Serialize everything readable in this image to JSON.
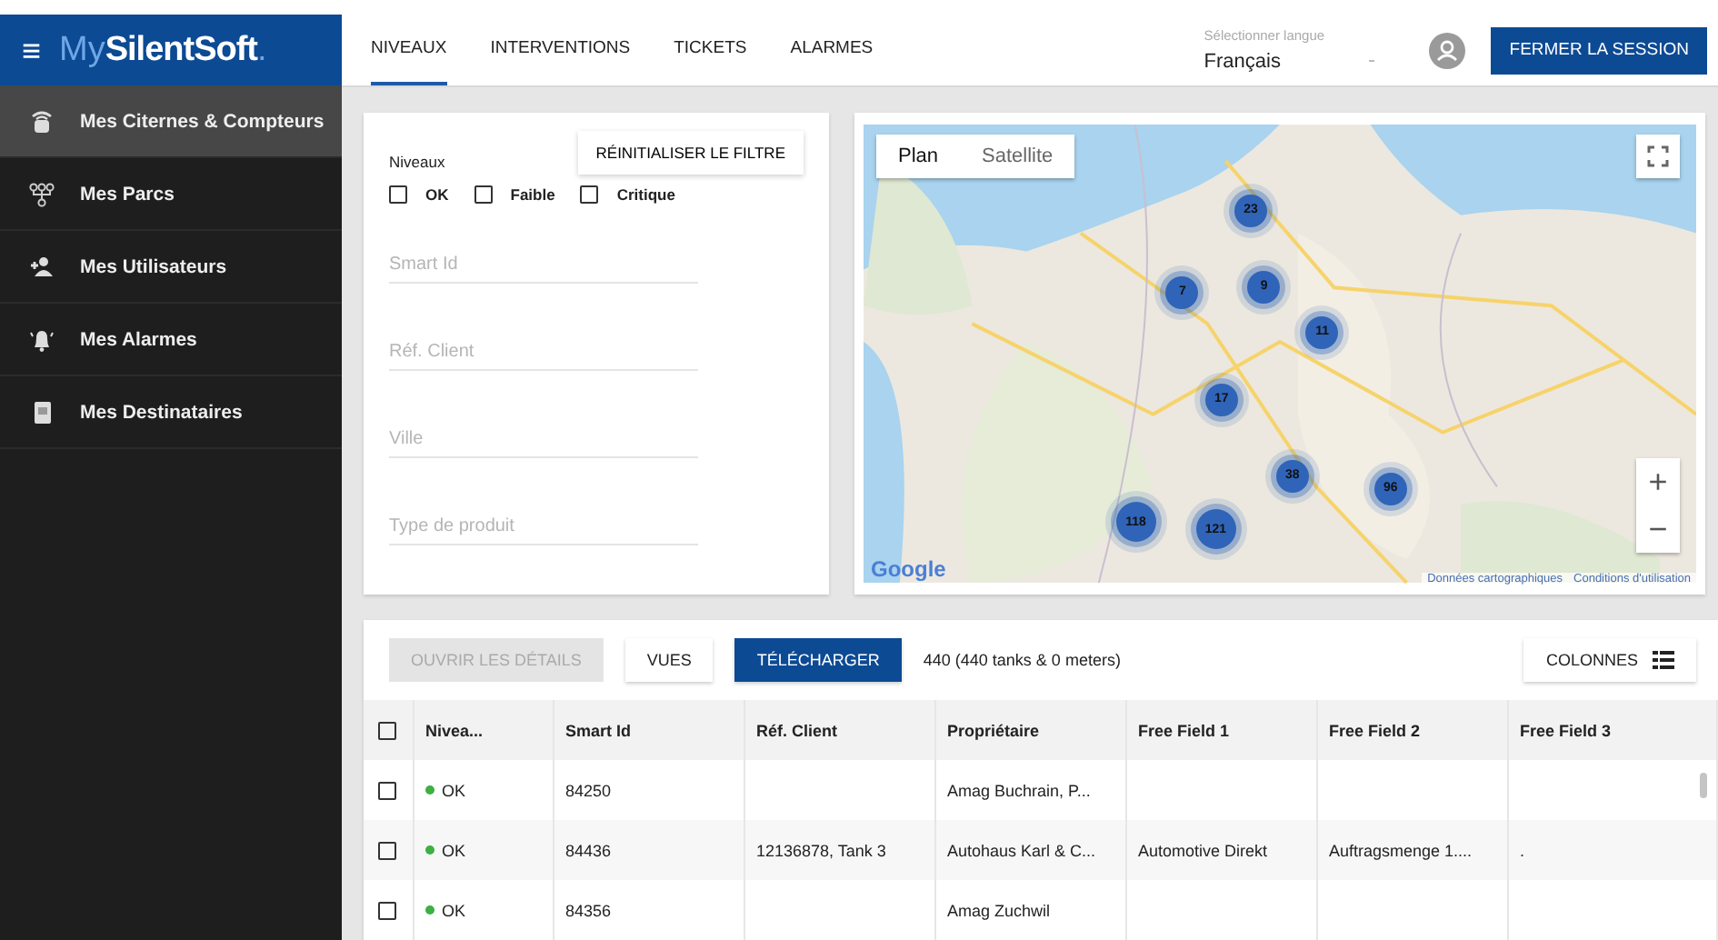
{
  "app": {
    "menu_icon": "≡",
    "logo_light": "My",
    "logo_bold": "SilentSoft",
    "logo_dot": "."
  },
  "sidebar": {
    "items": [
      {
        "label": "Mes Citernes & Compteurs",
        "kind": "tank",
        "selected": true
      },
      {
        "label": "Mes Parcs",
        "kind": "network",
        "selected": false
      },
      {
        "label": "Mes Utilisateurs",
        "kind": "users",
        "selected": false
      },
      {
        "label": "Mes Alarmes",
        "kind": "bell",
        "selected": false
      },
      {
        "label": "Mes Destinataires",
        "kind": "book",
        "selected": false
      }
    ]
  },
  "tabs": [
    {
      "label": "NIVEAUX",
      "selected": true
    },
    {
      "label": "INTERVENTIONS",
      "selected": false
    },
    {
      "label": "TICKETS",
      "selected": false
    },
    {
      "label": "ALARMES",
      "selected": false
    }
  ],
  "language": {
    "label": "Sélectionner langue",
    "value": "Français"
  },
  "logout_button": "FERMER LA SESSION",
  "filter": {
    "reset_button": "RÉINITIALISER LE FILTRE",
    "levels_label": "Niveaux",
    "levels": [
      {
        "label": "OK",
        "checked": false
      },
      {
        "label": "Faible",
        "checked": false
      },
      {
        "label": "Critique",
        "checked": false
      }
    ],
    "fields": [
      {
        "placeholder": "Smart Id"
      },
      {
        "placeholder": "Réf. Client"
      },
      {
        "placeholder": "Ville"
      },
      {
        "placeholder": "Type de produit"
      }
    ]
  },
  "map": {
    "kind": "picture",
    "types": [
      {
        "label": "Plan",
        "selected": true
      },
      {
        "label": "Satellite",
        "selected": false
      }
    ],
    "zoom_in": "+",
    "zoom_out": "−",
    "attribution": "Google",
    "links": [
      "Données cartographiques",
      "Conditions d'utilisation"
    ],
    "clusters": [
      "23",
      "7",
      "9",
      "11",
      "17",
      "38",
      "96",
      "118",
      "121"
    ]
  },
  "toolbar": {
    "buttons": [
      {
        "label": "OUVRIR LES DÉTAILS",
        "kind": "disabled"
      },
      {
        "label": "VUES",
        "kind": "plain"
      },
      {
        "label": "TÉLÉCHARGER",
        "kind": "primary"
      }
    ],
    "count": "440 (440 tanks & 0 meters)",
    "columns_button": "COLONNES"
  },
  "table": {
    "select_all_checked": false,
    "columns": [
      "Nivea...",
      "Smart Id",
      "Réf. Client",
      "Propriétaire",
      "Free Field 1",
      "Free Field 2",
      "Free Field 3"
    ],
    "rows": [
      {
        "checked": false,
        "color": "#3cb043",
        "cells": [
          "OK",
          "84250",
          "",
          "Amag Buchrain, P...",
          "",
          "",
          ""
        ]
      },
      {
        "checked": false,
        "color": "#3cb043",
        "cells": [
          "OK",
          "84436",
          "12136878, Tank 3",
          "Autohaus Karl & C...",
          "Automotive Direkt",
          "Auftragsmenge 1....",
          "."
        ]
      },
      {
        "checked": false,
        "color": "#3cb043",
        "cells": [
          "OK",
          "84356",
          "",
          "Amag Zuchwil",
          "",
          "",
          ""
        ]
      }
    ]
  }
}
